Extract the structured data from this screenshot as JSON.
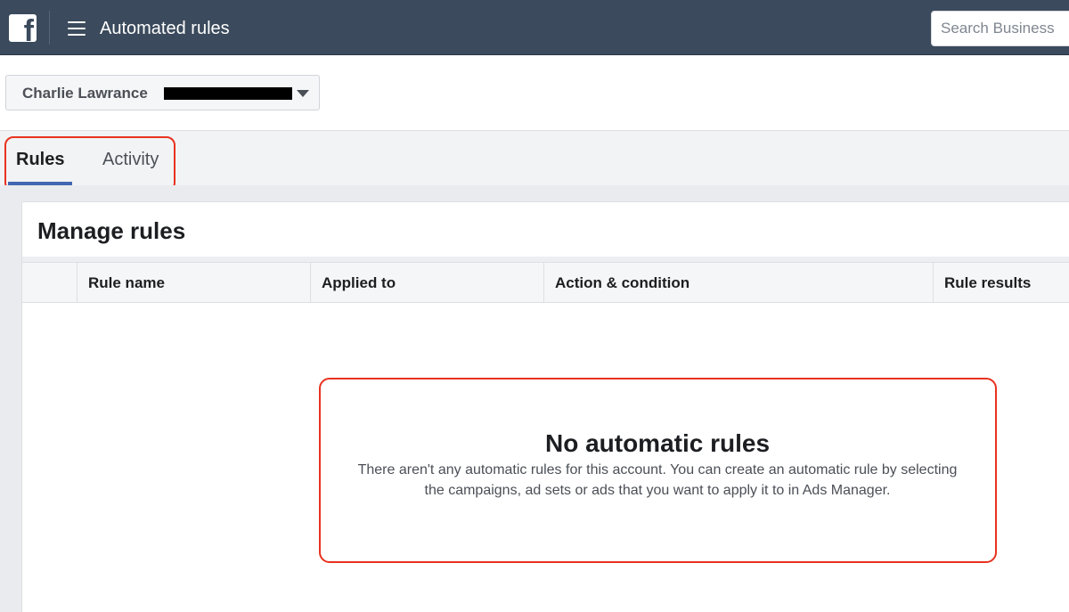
{
  "header": {
    "logo_letter": "f",
    "title": "Automated rules",
    "search_placeholder": "Search Business"
  },
  "account": {
    "name": "Charlie Lawrance"
  },
  "tabs": [
    {
      "label": "Rules",
      "active": true
    },
    {
      "label": "Activity",
      "active": false
    }
  ],
  "manage": {
    "title": "Manage rules",
    "columns": [
      "Rule name",
      "Applied to",
      "Action & condition",
      "Rule results"
    ]
  },
  "empty_state": {
    "title": "No automatic rules",
    "description": "There aren't any automatic rules for this account. You can create an automatic rule by selecting the campaigns, ad sets or ads that you want to apply it to in Ads Manager."
  },
  "colors": {
    "topbar": "#3b4a5c",
    "accent": "#4267b2",
    "annotation": "#e8321f"
  }
}
